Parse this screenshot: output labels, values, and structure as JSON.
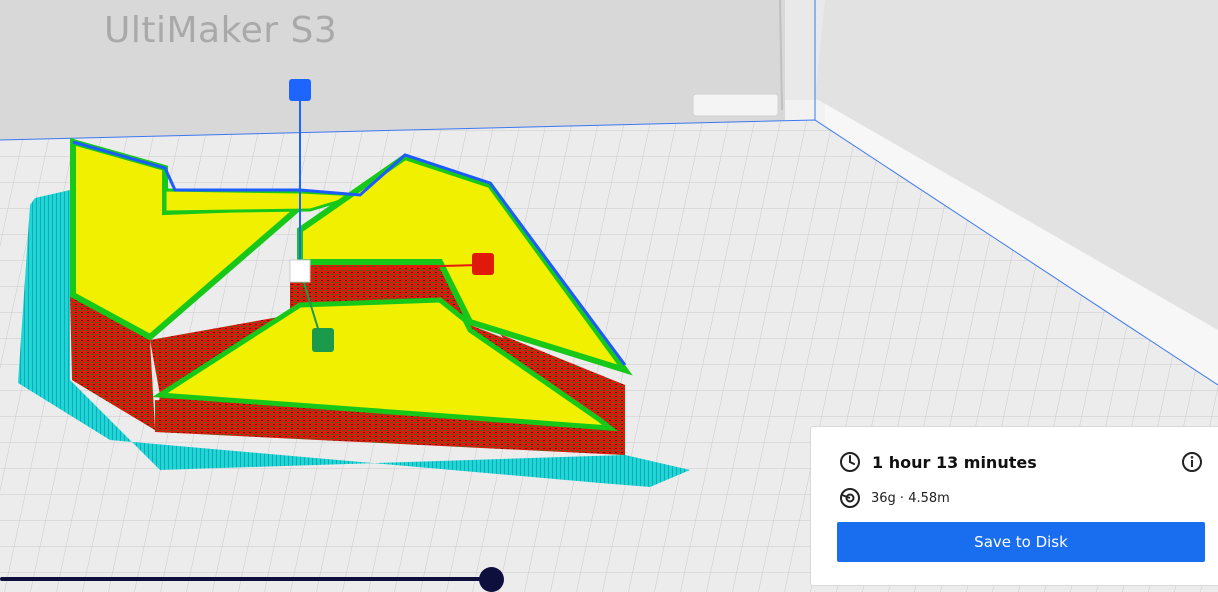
{
  "printer": {
    "name": "UltiMaker S3"
  },
  "print_info": {
    "time": "1 hour 13 minutes",
    "material": "36g · 4.58m",
    "save_label": "Save to Disk",
    "time_icon": "clock-icon",
    "material_icon": "filament-spool-icon",
    "info_icon": "info-icon"
  },
  "layer_slider": {
    "position": 0.98
  },
  "colors": {
    "accent": "#196ef0",
    "skirt": "#19e6e6",
    "wall": "#e61a0a",
    "top_skin": "#f2f200",
    "inner_wall": "#22dd22",
    "outline": "#1e64ff",
    "slider": "#0f0f3d"
  }
}
